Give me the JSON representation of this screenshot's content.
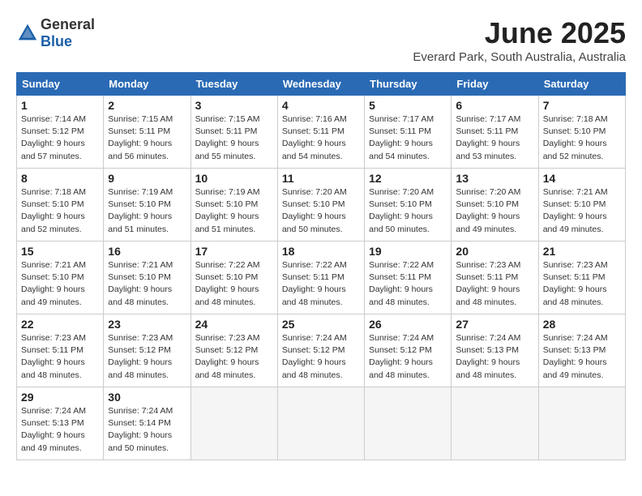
{
  "logo": {
    "general": "General",
    "blue": "Blue"
  },
  "title": "June 2025",
  "location": "Everard Park, South Australia, Australia",
  "headers": [
    "Sunday",
    "Monday",
    "Tuesday",
    "Wednesday",
    "Thursday",
    "Friday",
    "Saturday"
  ],
  "weeks": [
    [
      {
        "day": "1",
        "sunrise": "7:14 AM",
        "sunset": "5:12 PM",
        "daylight": "9 hours and 57 minutes."
      },
      {
        "day": "2",
        "sunrise": "7:15 AM",
        "sunset": "5:11 PM",
        "daylight": "9 hours and 56 minutes."
      },
      {
        "day": "3",
        "sunrise": "7:15 AM",
        "sunset": "5:11 PM",
        "daylight": "9 hours and 55 minutes."
      },
      {
        "day": "4",
        "sunrise": "7:16 AM",
        "sunset": "5:11 PM",
        "daylight": "9 hours and 54 minutes."
      },
      {
        "day": "5",
        "sunrise": "7:17 AM",
        "sunset": "5:11 PM",
        "daylight": "9 hours and 54 minutes."
      },
      {
        "day": "6",
        "sunrise": "7:17 AM",
        "sunset": "5:11 PM",
        "daylight": "9 hours and 53 minutes."
      },
      {
        "day": "7",
        "sunrise": "7:18 AM",
        "sunset": "5:10 PM",
        "daylight": "9 hours and 52 minutes."
      }
    ],
    [
      {
        "day": "8",
        "sunrise": "7:18 AM",
        "sunset": "5:10 PM",
        "daylight": "9 hours and 52 minutes."
      },
      {
        "day": "9",
        "sunrise": "7:19 AM",
        "sunset": "5:10 PM",
        "daylight": "9 hours and 51 minutes."
      },
      {
        "day": "10",
        "sunrise": "7:19 AM",
        "sunset": "5:10 PM",
        "daylight": "9 hours and 51 minutes."
      },
      {
        "day": "11",
        "sunrise": "7:20 AM",
        "sunset": "5:10 PM",
        "daylight": "9 hours and 50 minutes."
      },
      {
        "day": "12",
        "sunrise": "7:20 AM",
        "sunset": "5:10 PM",
        "daylight": "9 hours and 50 minutes."
      },
      {
        "day": "13",
        "sunrise": "7:20 AM",
        "sunset": "5:10 PM",
        "daylight": "9 hours and 49 minutes."
      },
      {
        "day": "14",
        "sunrise": "7:21 AM",
        "sunset": "5:10 PM",
        "daylight": "9 hours and 49 minutes."
      }
    ],
    [
      {
        "day": "15",
        "sunrise": "7:21 AM",
        "sunset": "5:10 PM",
        "daylight": "9 hours and 49 minutes."
      },
      {
        "day": "16",
        "sunrise": "7:21 AM",
        "sunset": "5:10 PM",
        "daylight": "9 hours and 48 minutes."
      },
      {
        "day": "17",
        "sunrise": "7:22 AM",
        "sunset": "5:10 PM",
        "daylight": "9 hours and 48 minutes."
      },
      {
        "day": "18",
        "sunrise": "7:22 AM",
        "sunset": "5:11 PM",
        "daylight": "9 hours and 48 minutes."
      },
      {
        "day": "19",
        "sunrise": "7:22 AM",
        "sunset": "5:11 PM",
        "daylight": "9 hours and 48 minutes."
      },
      {
        "day": "20",
        "sunrise": "7:23 AM",
        "sunset": "5:11 PM",
        "daylight": "9 hours and 48 minutes."
      },
      {
        "day": "21",
        "sunrise": "7:23 AM",
        "sunset": "5:11 PM",
        "daylight": "9 hours and 48 minutes."
      }
    ],
    [
      {
        "day": "22",
        "sunrise": "7:23 AM",
        "sunset": "5:11 PM",
        "daylight": "9 hours and 48 minutes."
      },
      {
        "day": "23",
        "sunrise": "7:23 AM",
        "sunset": "5:12 PM",
        "daylight": "9 hours and 48 minutes."
      },
      {
        "day": "24",
        "sunrise": "7:23 AM",
        "sunset": "5:12 PM",
        "daylight": "9 hours and 48 minutes."
      },
      {
        "day": "25",
        "sunrise": "7:24 AM",
        "sunset": "5:12 PM",
        "daylight": "9 hours and 48 minutes."
      },
      {
        "day": "26",
        "sunrise": "7:24 AM",
        "sunset": "5:12 PM",
        "daylight": "9 hours and 48 minutes."
      },
      {
        "day": "27",
        "sunrise": "7:24 AM",
        "sunset": "5:13 PM",
        "daylight": "9 hours and 48 minutes."
      },
      {
        "day": "28",
        "sunrise": "7:24 AM",
        "sunset": "5:13 PM",
        "daylight": "9 hours and 49 minutes."
      }
    ],
    [
      {
        "day": "29",
        "sunrise": "7:24 AM",
        "sunset": "5:13 PM",
        "daylight": "9 hours and 49 minutes."
      },
      {
        "day": "30",
        "sunrise": "7:24 AM",
        "sunset": "5:14 PM",
        "daylight": "9 hours and 50 minutes."
      },
      null,
      null,
      null,
      null,
      null
    ]
  ]
}
